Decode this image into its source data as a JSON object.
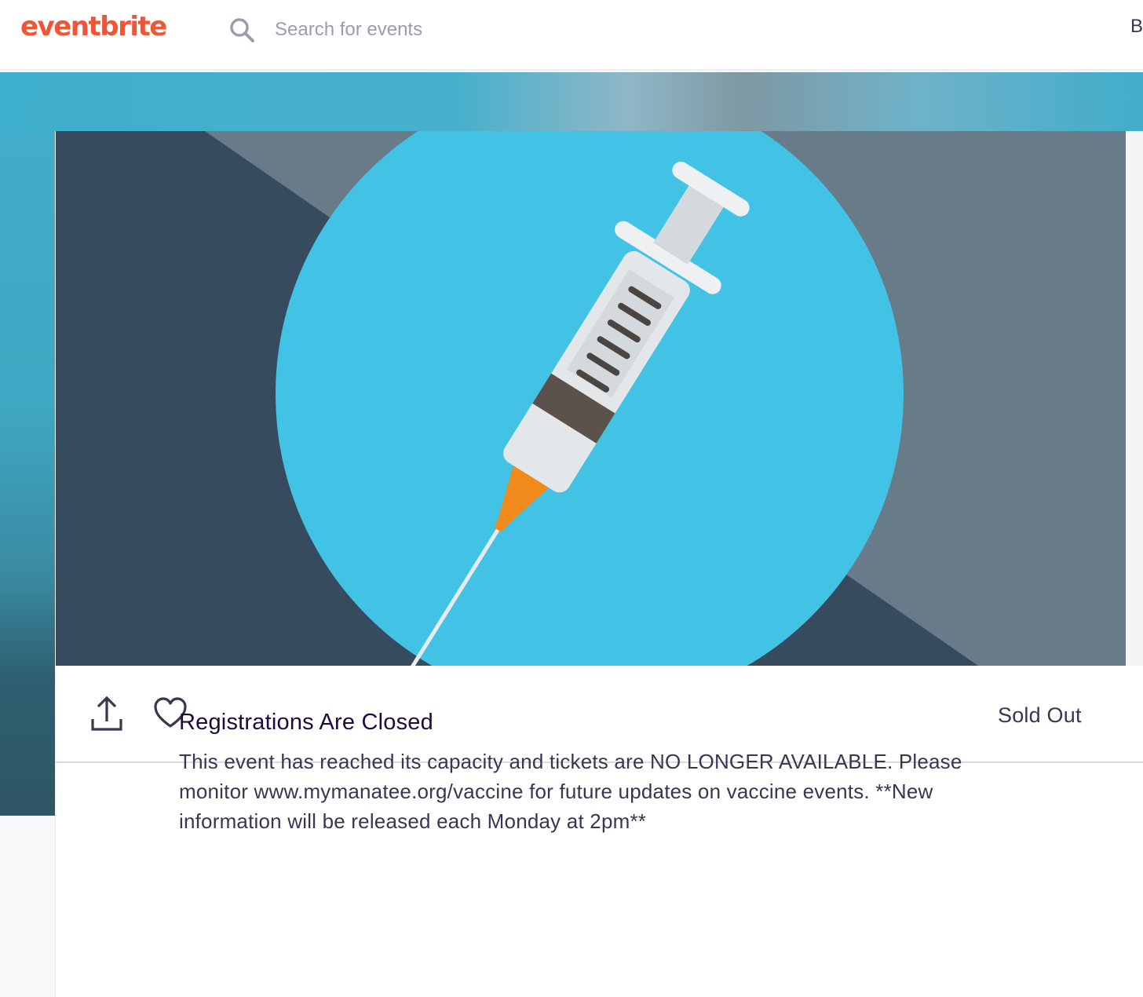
{
  "header": {
    "logo_text": "eventbrite",
    "search_placeholder": "Search for events",
    "nav_partial": "B"
  },
  "event": {
    "status": "Sold Out",
    "notice_title": "Registrations Are Closed",
    "notice_body": "This event has reached its capacity and tickets are NO LONGER AVAILABLE. Please monitor www.mymanatee.org/vaccine for future updates on vaccine events. **New information will be released each Monday at 2pm**"
  },
  "icons": {
    "search": "search-icon",
    "share": "share-icon",
    "like": "heart-icon"
  },
  "colors": {
    "brand": "#f05537",
    "text_dark": "#1e0a3c",
    "text": "#39364f",
    "hero_circle": "#42c3e5",
    "hero_dark": "#364c5e",
    "hero_slate": "#687b88"
  }
}
